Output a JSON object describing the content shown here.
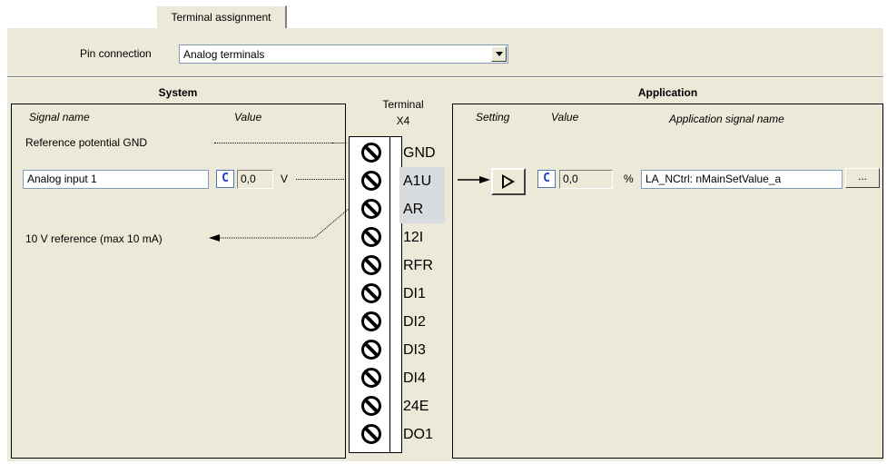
{
  "tab": {
    "label": "Terminal assignment"
  },
  "pin_connection": {
    "label": "Pin connection",
    "value": "Analog terminals"
  },
  "system": {
    "title": "System",
    "col_signal_name": "Signal name",
    "col_value": "Value",
    "rows": [
      {
        "label": "Reference potential GND"
      },
      {
        "input_value": "Analog input 1",
        "c_label": "C",
        "value": "0,0",
        "unit": "V"
      },
      {
        "label": "10 V reference (max 10 mA)"
      }
    ]
  },
  "terminal": {
    "title": "Terminal",
    "subtitle": "X4",
    "pins": [
      "GND",
      "A1U",
      "AR",
      "12I",
      "RFR",
      "DI1",
      "DI2",
      "DI3",
      "DI4",
      "24E",
      "DO1"
    ]
  },
  "application": {
    "title": "Application",
    "col_setting": "Setting",
    "col_value": "Value",
    "col_app_signal": "Application signal name",
    "row": {
      "c_label": "C",
      "value": "0,0",
      "unit": "%",
      "signal": "LA_NCtrl: nMainSetValue_a",
      "browse_label": "..."
    }
  },
  "icons": {
    "dropdown": "chevron-down-icon",
    "apply": "play-triangle-icon",
    "screw": "screw-terminal-icon"
  },
  "colors": {
    "panel_bg": "#ece9d8",
    "c_button": "#1a3fc8",
    "highlight": "#d9dcdf"
  }
}
